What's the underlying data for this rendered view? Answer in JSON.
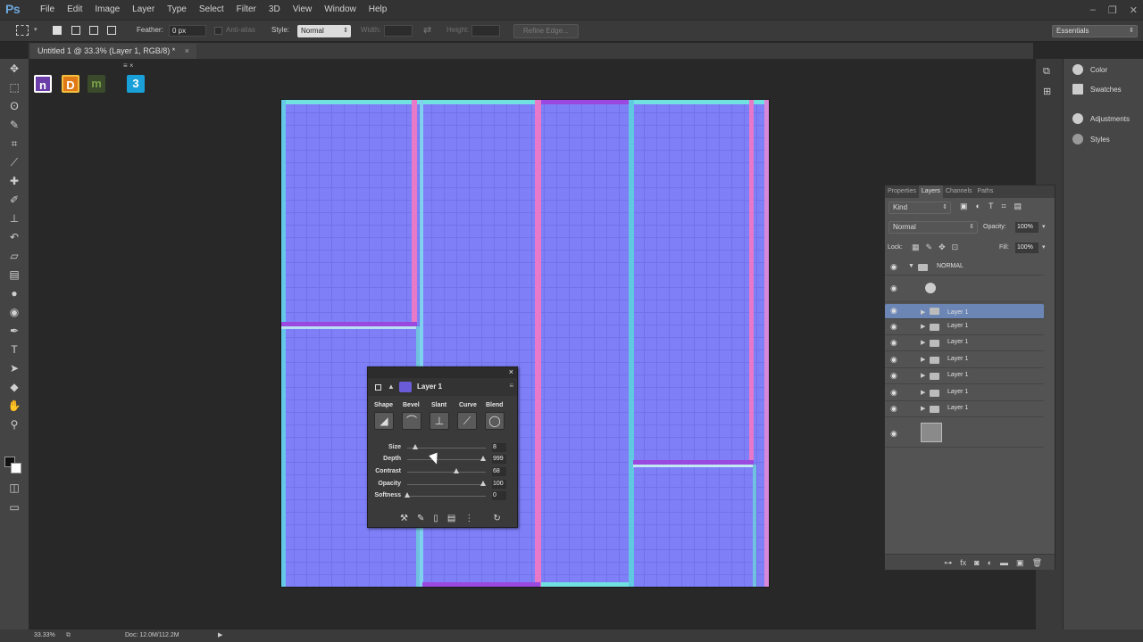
{
  "app": {
    "logo": "Ps"
  },
  "menu": [
    "File",
    "Edit",
    "Image",
    "Layer",
    "Type",
    "Select",
    "Filter",
    "3D",
    "View",
    "Window",
    "Help"
  ],
  "window_controls": [
    "minimize",
    "restore",
    "close"
  ],
  "options": {
    "feather_label": "Feather:",
    "feather_value": "0 px",
    "antialias": "Anti-alias",
    "style_label": "Style:",
    "style_value": "Normal",
    "width_label": "Width:",
    "height_label": "Height:",
    "refine_edge": "Refine Edge...",
    "workspace": "Essentials"
  },
  "document": {
    "tab_title": "Untitled 1 @ 33.3% (Layer 1, RGB/8) *",
    "zoom": "33.33%",
    "doc_size": "Doc: 12.0M/112.2M"
  },
  "tools": [
    "move-icon",
    "marquee-icon",
    "lasso-icon",
    "quick-select-icon",
    "crop-icon",
    "eyedropper-icon",
    "healing-icon",
    "brush-icon",
    "stamp-icon",
    "history-brush-icon",
    "eraser-icon",
    "gradient-icon",
    "blur-icon",
    "dodge-icon",
    "pen-icon",
    "type-icon",
    "path-select-icon",
    "shape-icon",
    "hand-icon",
    "zoom-icon"
  ],
  "plugins": [
    "n",
    "D",
    "m",
    "3"
  ],
  "right_panel": {
    "items": [
      "Color",
      "Swatches",
      "Adjustments",
      "Styles"
    ]
  },
  "layers_panel": {
    "tabs": [
      "Properties",
      "Layers",
      "Channels",
      "Paths"
    ],
    "active_tab": "Layers",
    "filter": "Kind",
    "blend_mode": "Normal",
    "opacity_label": "Opacity:",
    "opacity_value": "100%",
    "lock_label": "Lock:",
    "fill_label": "Fill:",
    "fill_value": "100%",
    "group_name": "NORMAL",
    "layers": [
      "Layer 1",
      "Layer 1",
      "Layer 1",
      "Layer 1",
      "Layer 1",
      "Layer 1",
      "Layer 1"
    ],
    "selected_index": 0
  },
  "ndo_panel": {
    "layer_name": "Layer 1",
    "buttons": [
      "Shape",
      "Bevel",
      "Slant",
      "Curve",
      "Blend"
    ],
    "sliders": [
      {
        "label": "Size",
        "value": "8",
        "level": 0.1
      },
      {
        "label": "Depth",
        "value": "999",
        "level": 0.97
      },
      {
        "label": "Contrast",
        "value": "68",
        "level": 0.63
      },
      {
        "label": "Opacity",
        "value": "100",
        "level": 0.97
      },
      {
        "label": "Softness",
        "value": "0",
        "level": 0.0
      }
    ]
  },
  "colors": {
    "normal_base": "#7f7ff8",
    "edge_cyan": "#66d8e8",
    "edge_pink": "#e878c8",
    "edge_magenta": "#9a48e0",
    "selected_layer": "#6b85b5"
  }
}
